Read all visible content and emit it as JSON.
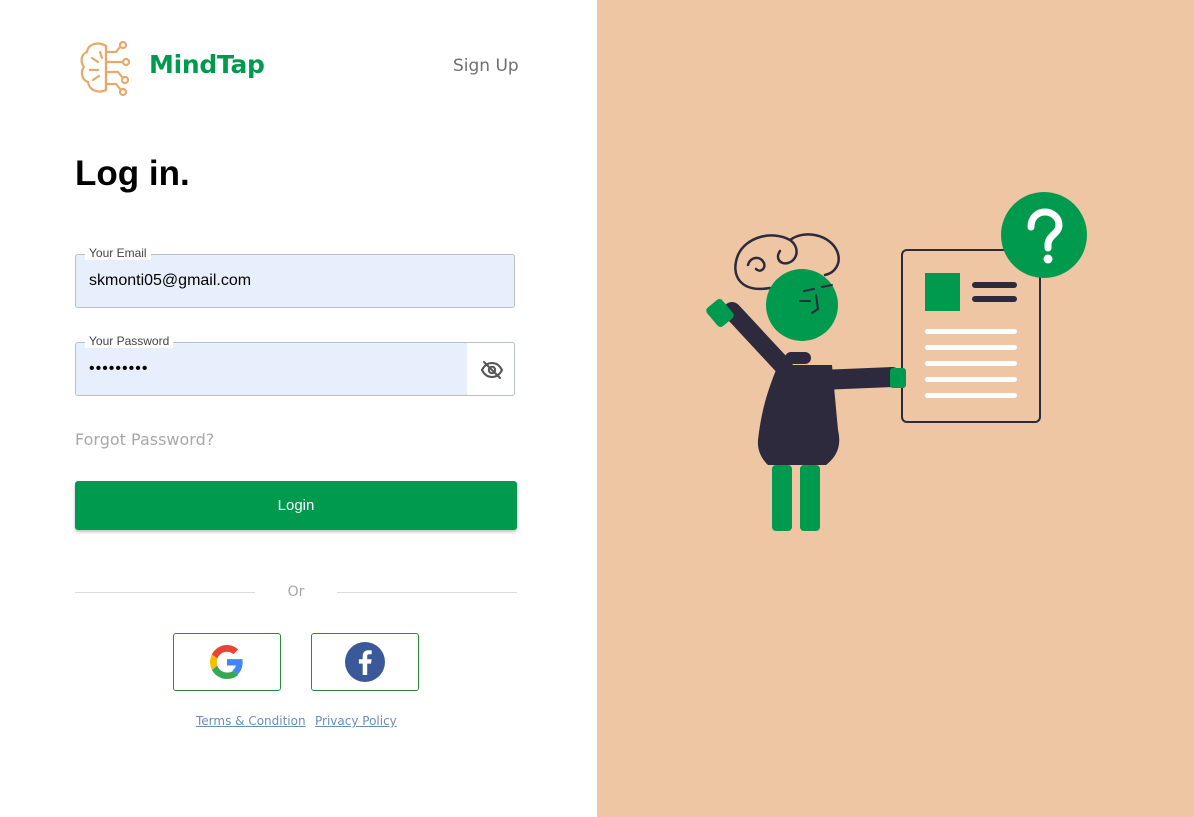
{
  "app": {
    "brand": "MindTap",
    "logo_icon": "brain-circuit-icon"
  },
  "header": {
    "signup_label": "Sign Up"
  },
  "form": {
    "title": "Log in.",
    "email": {
      "label": "Your Email",
      "value": "skmonti05@gmail.com"
    },
    "password": {
      "label": "Your Password",
      "value": "•••••••••",
      "toggle_icon": "eye-off-icon"
    },
    "forgot_label": "Forgot Password?",
    "login_label": "Login",
    "divider_label": "Or"
  },
  "social": {
    "google_icon": "google-icon",
    "facebook_icon": "facebook-icon"
  },
  "footer": {
    "terms_label": "Terms & Condition",
    "privacy_label": "Privacy Policy"
  },
  "colors": {
    "accent": "#009a4e",
    "panel_bg": "#eec6a3",
    "input_bg": "#e8effc",
    "logo": "#e8a86a",
    "figure_dark": "#2d2a3e"
  }
}
